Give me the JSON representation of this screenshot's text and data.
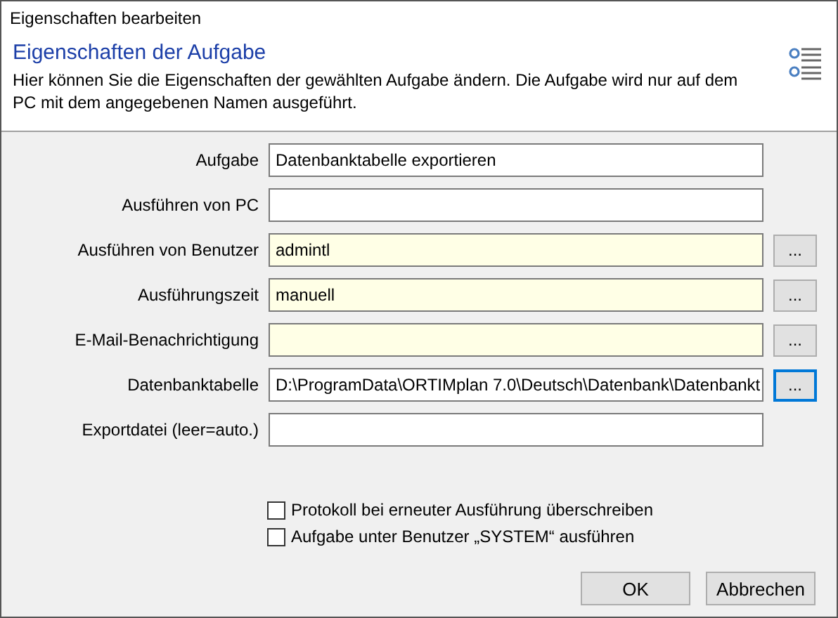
{
  "window": {
    "title": "Eigenschaften bearbeiten"
  },
  "header": {
    "title": "Eigenschaften der Aufgabe",
    "description": "Hier können Sie die Eigenschaften der gewählten Aufgabe ändern. Die Aufgabe wird nur auf dem PC mit dem angegebenen Namen ausgeführt."
  },
  "fields": [
    {
      "label": "Aufgabe",
      "value": "Datenbanktabelle exportieren",
      "highlighted": false
    },
    {
      "label": "Ausführen von PC",
      "highlighted": false
    },
    {
      "label": "Ausführen von Benutzer",
      "value": "admintl",
      "highlighted": true,
      "browse": {
        "label": "...",
        "focused": false
      }
    },
    {
      "label": "Ausführungszeit",
      "value": "manuell",
      "highlighted": true,
      "browse": {
        "label": "...",
        "focused": false
      }
    },
    {
      "label": "E-Mail-Benachrichtigung",
      "highlighted": true,
      "browse": {
        "label": "...",
        "focused": false
      }
    },
    {
      "label": "Datenbanktabelle",
      "value": "D:\\ProgramData\\ORTIMplan 7.0\\Deutsch\\Datenbank\\Datenbankt",
      "highlighted": false,
      "browse": {
        "label": "...",
        "focused": true
      }
    },
    {
      "label": "Exportdatei (leer=auto.)",
      "highlighted": false
    }
  ],
  "options": [
    {
      "label": "Protokoll bei erneuter Ausführung überschreiben",
      "checked": false
    },
    {
      "label": "Aufgabe unter Benutzer „SYSTEM“ ausführen",
      "checked": false
    }
  ],
  "buttons": [
    "OK",
    "Abbrechen"
  ]
}
